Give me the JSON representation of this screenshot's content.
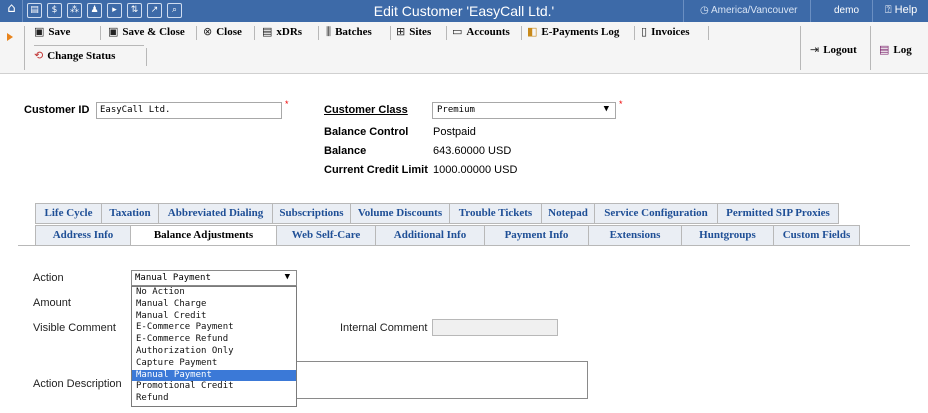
{
  "topbar": {
    "title": "Edit Customer 'EasyCall Ltd.'",
    "timezone": "America/Vancouver",
    "user": "demo",
    "help": "Help",
    "icons": [
      "home-icon",
      "grid-icon",
      "dollar-icon",
      "network-icon",
      "person-icon",
      "terminal-icon",
      "transfer-icon",
      "chart-icon",
      "search-icon"
    ]
  },
  "toolbar": {
    "save": "Save",
    "save_close": "Save & Close",
    "close": "Close",
    "xdrs": "xDRs",
    "batches": "Batches",
    "sites": "Sites",
    "accounts": "Accounts",
    "epayments_log": "E-Payments Log",
    "invoices": "Invoices",
    "change_status": "Change Status",
    "logout": "Logout",
    "log": "Log"
  },
  "customer": {
    "id_label": "Customer ID",
    "id_value": "EasyCall Ltd.",
    "class_label": "Customer Class",
    "class_value": "Premium",
    "balance_control_label": "Balance Control",
    "balance_control_value": "Postpaid",
    "balance_label": "Balance",
    "balance_value": "643.60000 USD",
    "credit_limit_label": "Current Credit Limit",
    "credit_limit_value": "1000.00000 USD"
  },
  "tabs": {
    "row1": [
      "Life Cycle",
      "Taxation",
      "Abbreviated Dialing",
      "Subscriptions",
      "Volume Discounts",
      "Trouble Tickets",
      "Notepad",
      "Service Configuration",
      "Permitted SIP Proxies"
    ],
    "row2": [
      "Address Info",
      "Balance Adjustments",
      "Web Self-Care",
      "Additional Info",
      "Payment Info",
      "Extensions",
      "Huntgroups",
      "Custom Fields"
    ],
    "active": "Balance Adjustments"
  },
  "form": {
    "action_label": "Action",
    "action_value": "Manual Payment",
    "amount_label": "Amount",
    "visible_comment_label": "Visible Comment",
    "internal_comment_label": "Internal Comment",
    "action_description_label": "Action Description",
    "action_options": [
      "No Action",
      "Manual Charge",
      "Manual Credit",
      "E-Commerce Payment",
      "E-Commerce Refund",
      "Authorization Only",
      "Capture Payment",
      "Manual Payment",
      "Promotional Credit",
      "Refund"
    ],
    "selected_option": "Manual Payment"
  },
  "colors": {
    "topbar": "#3d6aa8",
    "tab_text": "#1f4f96",
    "selection": "#3b79d7",
    "accent_arrow": "#e8831b",
    "required": "#ee0000"
  }
}
